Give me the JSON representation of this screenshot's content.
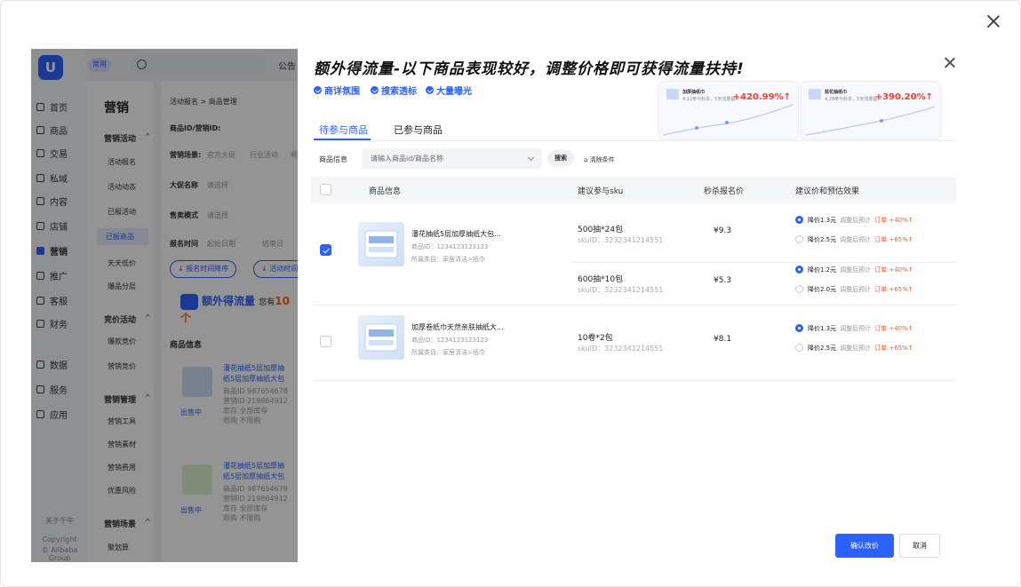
{
  "background": {
    "logo": "U",
    "top_pill": "常用",
    "notice": "公告",
    "rail": [
      "首页",
      "商品",
      "交易",
      "私域",
      "内容",
      "店铺",
      "营销",
      "推广",
      "客服",
      "财务",
      "数据",
      "服务",
      "应用"
    ],
    "rail_footer": [
      "关于千牛",
      "Copyright",
      "© Alibaba Group"
    ],
    "sub_title": "营销",
    "sub_items": [
      {
        "label": "营销活动",
        "group": true,
        "arrow": "^"
      },
      {
        "label": "活动报名"
      },
      {
        "label": "活动动态"
      },
      {
        "label": "已报活动"
      },
      {
        "label": "已报商品",
        "selected": true
      },
      {
        "label": "天天低价"
      },
      {
        "label": "爆品分层"
      },
      {
        "label": "竞价活动",
        "group": true,
        "arrow": "^"
      },
      {
        "label": "爆款竞价"
      },
      {
        "label": "营销竞价"
      },
      {
        "label": "营销管理",
        "group": true,
        "arrow": "^"
      },
      {
        "label": "营销工具"
      },
      {
        "label": "营销素材"
      },
      {
        "label": "营销费用"
      },
      {
        "label": "优惠风险"
      },
      {
        "label": "营销场景",
        "group": true,
        "arrow": "^"
      },
      {
        "label": "聚划算"
      }
    ],
    "breadcrumb": "活动报名 > 商品管理",
    "field_label": "商品ID/营销ID:",
    "scene_label": "营销场景:",
    "scene_opts": [
      "官方大促",
      "行业活动",
      "频"
    ],
    "promo_name": "大促名称",
    "promo_ph": "请选择",
    "sale_mode": "售卖模式",
    "sale_ph": "请选择",
    "signup_time": "报名时间",
    "start_date": "起始日期",
    "end_date": "结束日",
    "sort1": "↓ 报名时间降序",
    "sort2": "↓ 活动时间",
    "banner_text": "额外得流量",
    "banner_tail": "您有",
    "banner_num": "10个",
    "col_info": "商品信息",
    "items": [
      {
        "name1": "潘花抽纸5层加厚抽",
        "name2": "纸5层加厚抽纸大包",
        "meta1": "商品ID 987654678",
        "meta2": "营销ID 219864912",
        "meta3": "库存 全部库存",
        "meta4": "限购 不限购",
        "status": "出售中"
      },
      {
        "name1": "潘花抽纸5层加厚抽",
        "name2": "纸5层加厚抽纸大包",
        "meta1": "商品ID 987654678",
        "meta2": "营销ID 219864912",
        "meta3": "库存 全部库存",
        "meta4": "限购 不限购",
        "status": "出售中"
      }
    ]
  },
  "modal": {
    "title": "额外得流量-以下商品表现较好，调整价格即可获得流量扶持!",
    "features": [
      "商详氛围",
      "搜索透标",
      "大量曝光"
    ],
    "cards": [
      {
        "title": "加厚抽纸巾",
        "sub": "4.12参与秒杀，5天流量提升",
        "pct": "+420.99%↑"
      },
      {
        "title": "蓝花抽纸巾",
        "sub": "4.28参与秒杀，5天流量提升",
        "pct": "+390.20%↑"
      }
    ],
    "tabs": [
      "待参与商品",
      "已参与商品"
    ],
    "filter_label": "商品信息",
    "filter_placeholder": "请输入商品id/商品名称",
    "search_btn": "搜索",
    "clear_btn": "清除条件",
    "headers": [
      "商品信息",
      "建议参与sku",
      "秒杀报名价",
      "建议价和预估效果"
    ],
    "products": [
      {
        "checked": true,
        "name": "潘花抽纸5层加厚抽纸大包...",
        "id": "商品ID：1234123123123",
        "category": "所属类目：家居清洁>纸巾",
        "skus": [
          {
            "sku": "500抽*24包",
            "sku_id": "skuID：3232341214551",
            "price": "¥9.3",
            "options": [
              {
                "on": true,
                "a": "降价1.3元",
                "b": "调整后预计",
                "c": "订单 +40%↑"
              },
              {
                "on": false,
                "a": "降价2.5元",
                "b": "调整后预计",
                "c": "订单 +65%↑"
              }
            ]
          },
          {
            "sku": "600抽*10包",
            "sku_id": "skuID：3232341214551",
            "price": "¥5.3",
            "options": [
              {
                "on": true,
                "a": "降价1.2元",
                "b": "调整后预计",
                "c": "订单 +40%↑"
              },
              {
                "on": false,
                "a": "降价2.0元",
                "b": "调整后预计",
                "c": "订单 +65%↑"
              }
            ]
          }
        ]
      },
      {
        "checked": false,
        "name": "加厚卷纸巾天然亲肤抽纸大...",
        "id": "商品ID：1234123123123",
        "category": "所属类目：家居清洁>纸巾",
        "skus": [
          {
            "sku": "10卷*2包",
            "sku_id": "skuID：3232341214551",
            "price": "¥8.1",
            "options": [
              {
                "on": true,
                "a": "降价1.3元",
                "b": "调整后预计",
                "c": "订单 +40%↑"
              },
              {
                "on": false,
                "a": "降价2.5元",
                "b": "调整后预计",
                "c": "订单 +65%↑"
              }
            ]
          }
        ]
      }
    ],
    "confirm_btn": "确认改价",
    "cancel_btn": "取消"
  }
}
